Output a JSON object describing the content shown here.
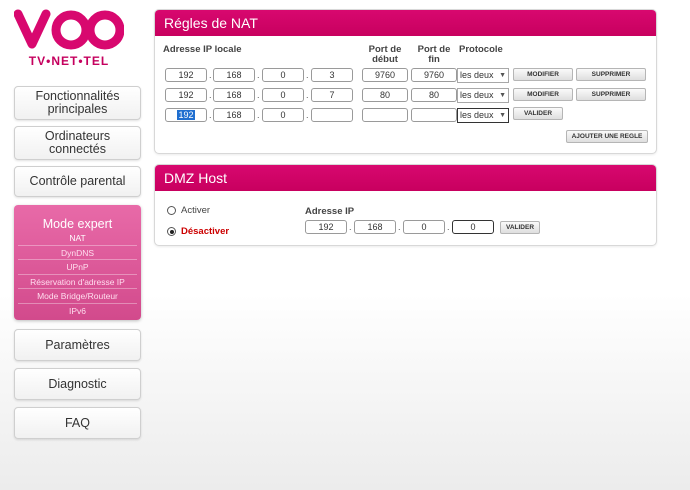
{
  "brand": {
    "sub": "TV•NET•TEL",
    "color": "#d8086f"
  },
  "sidebar": {
    "items": [
      "Fonctionnalités principales",
      "Ordinateurs connectés",
      "Contrôle parental"
    ],
    "expert": {
      "title": "Mode expert",
      "items": [
        "NAT",
        "DynDNS",
        "UPnP",
        "Réservation d'adresse IP",
        "Mode Bridge/Routeur",
        "IPv6"
      ],
      "active": "NAT"
    },
    "bottom": [
      "Paramètres",
      "Diagnostic",
      "FAQ"
    ]
  },
  "nat": {
    "title": "Régles de NAT",
    "headers": {
      "ip": "Adresse IP locale",
      "port_start": "Port de début",
      "port_end": "Port de fin",
      "protocol": "Protocole"
    },
    "rows": [
      {
        "ip": [
          "192",
          "168",
          "0",
          "3"
        ],
        "start": "9760",
        "end": "9760",
        "protocol": "les deux",
        "modify": "MODIFIER",
        "delete": "SUPPRIMER"
      },
      {
        "ip": [
          "192",
          "168",
          "0",
          "7"
        ],
        "start": "80",
        "end": "80",
        "protocol": "les deux",
        "modify": "MODIFIER",
        "delete": "SUPPRIMER"
      }
    ],
    "new_row": {
      "ip": [
        "192",
        "168",
        "0",
        ""
      ],
      "start": "",
      "end": "",
      "protocol": "les deux",
      "validate": "VALIDER"
    },
    "add_rule": "AJOUTER UNE REGLE"
  },
  "dmz": {
    "title": "DMZ Host",
    "activate": "Activer",
    "deactivate": "Désactiver",
    "selected": "deactivate",
    "ip_label": "Adresse IP",
    "ip": [
      "192",
      "168",
      "0",
      "0"
    ],
    "validate": "VALIDER"
  }
}
